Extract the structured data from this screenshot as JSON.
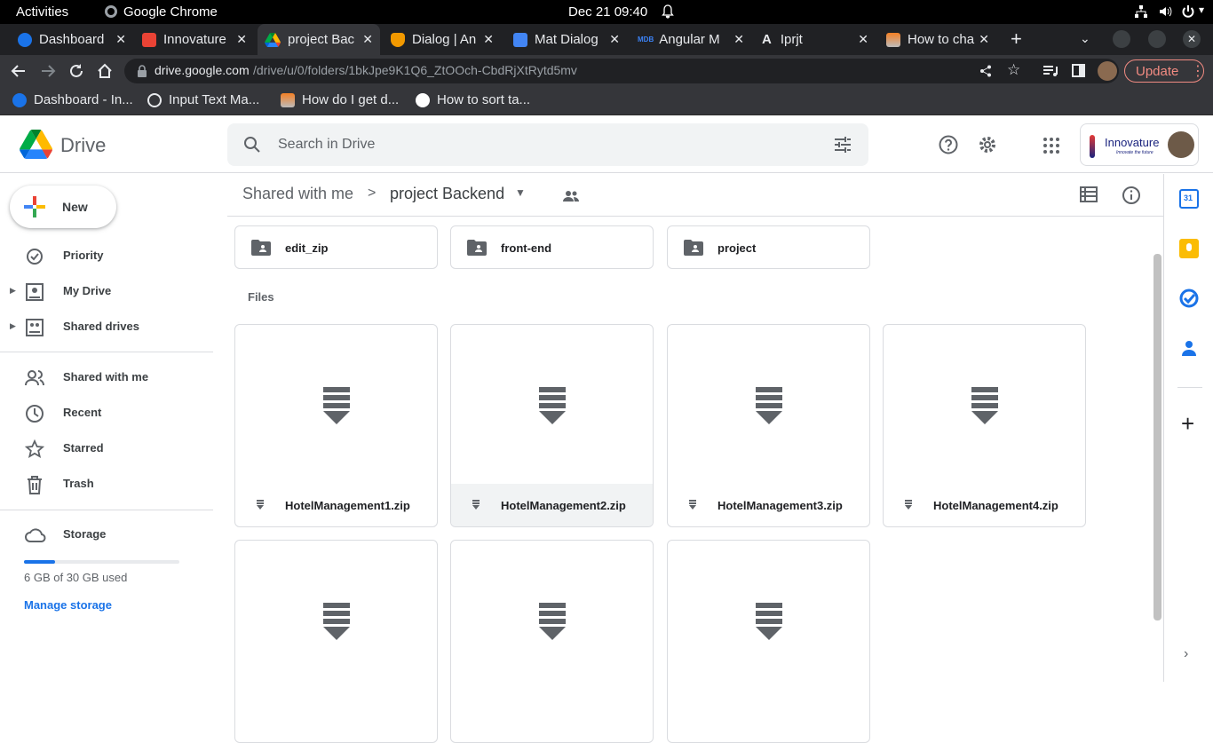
{
  "os": {
    "activities": "Activities",
    "app": "Google Chrome",
    "clock": "Dec 21  09:40"
  },
  "tabs": [
    {
      "title": "Dashboard",
      "close": "✕",
      "color": "#1a73e8"
    },
    {
      "title": "Innovature",
      "close": "✕",
      "color": "#ea4335"
    },
    {
      "title": "project Bac",
      "close": "✕",
      "color": "#34a853"
    },
    {
      "title": "Dialog | An",
      "close": "✕",
      "color": "#f29900"
    },
    {
      "title": "Mat Dialog",
      "close": "✕",
      "color": "#4285f4"
    },
    {
      "title": "Angular M",
      "close": "✕",
      "color": "#3b82f6"
    },
    {
      "title": "Iprjt",
      "close": "✕",
      "color": "#e8eaed"
    },
    {
      "title": "How to cha",
      "close": "✕",
      "color": "#f48024"
    }
  ],
  "newtab": "+",
  "address": {
    "host": "drive.google.com",
    "path": "/drive/u/0/folders/1bkJpe9K1Q6_ZtOOch-CbdRjXtRytd5mv"
  },
  "update_label": "Update",
  "bookmarks": [
    {
      "label": "Dashboard - In..."
    },
    {
      "label": "Input Text Ma..."
    },
    {
      "label": "How do I get d..."
    },
    {
      "label": "How to sort ta..."
    }
  ],
  "drive": {
    "logo_text": "Drive",
    "search_placeholder": "Search in Drive",
    "new_label": "New",
    "org_name": "Innovature",
    "org_tagline": "Innovate the future",
    "nav": [
      {
        "label": "Priority",
        "icon": "priority-icon"
      },
      {
        "label": "My Drive",
        "icon": "my-drive-icon"
      },
      {
        "label": "Shared drives",
        "icon": "shared-drives-icon"
      },
      {
        "label": "Shared with me",
        "icon": "shared-with-me-icon"
      },
      {
        "label": "Recent",
        "icon": "recent-icon"
      },
      {
        "label": "Starred",
        "icon": "star-icon"
      },
      {
        "label": "Trash",
        "icon": "trash-icon"
      }
    ],
    "storage": {
      "label": "Storage",
      "used_text": "6 GB of 30 GB used",
      "used_fraction": 0.2,
      "manage": "Manage storage"
    },
    "breadcrumb": {
      "parent": "Shared with me",
      "separator": ">",
      "current": "project Backend"
    },
    "folders": [
      {
        "name": "edit_zip"
      },
      {
        "name": "front-end"
      },
      {
        "name": "project"
      }
    ],
    "files_label": "Files",
    "files": [
      {
        "name": "HotelManagement1.zip"
      },
      {
        "name": "HotelManagement2.zip"
      },
      {
        "name": "HotelManagement3.zip"
      },
      {
        "name": "HotelManagement4.zip"
      },
      {
        "name": ""
      },
      {
        "name": ""
      },
      {
        "name": ""
      }
    ]
  },
  "colors": {
    "accent": "#1a73e8",
    "tab_bg": "#202124",
    "toolbar_bg": "#35363a"
  }
}
